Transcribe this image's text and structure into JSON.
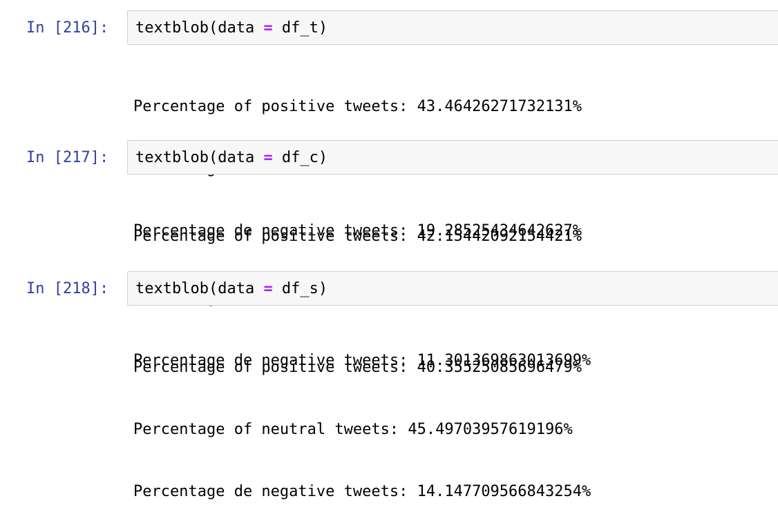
{
  "cells": [
    {
      "prompt": "In [216]:",
      "code": {
        "fn": "textblob(data ",
        "op": "=",
        "arg": " df_t)"
      },
      "output": [
        "Percentage of positive tweets: 43.46426271732131%",
        "Percentage of neutral tweets: 37.25048293625242%",
        "Percentage de negative tweets: 19.28525434642627%"
      ]
    },
    {
      "prompt": "In [217]:",
      "code": {
        "fn": "textblob(data ",
        "op": "=",
        "arg": " df_c)"
      },
      "output": [
        "Percentage of positive tweets: 42.15442092154421%",
        "Percentage of neutral tweets: 46.544209215442095%",
        "Percentage de negative tweets: 11.301369863013699%"
      ]
    },
    {
      "prompt": "In [218]:",
      "code": {
        "fn": "textblob(data ",
        "op": "=",
        "arg": " df_s)"
      },
      "output": [
        "Percentage of positive tweets: 40.35525085696479%",
        "Percentage of neutral tweets: 45.49703957619196%",
        "Percentage de negative tweets: 14.147709566843254%"
      ]
    }
  ],
  "colors": {
    "prompt": "#303f9f",
    "operator": "#aa22ff",
    "input_background": "#f7f7f7",
    "input_border": "#cfcfcf"
  }
}
